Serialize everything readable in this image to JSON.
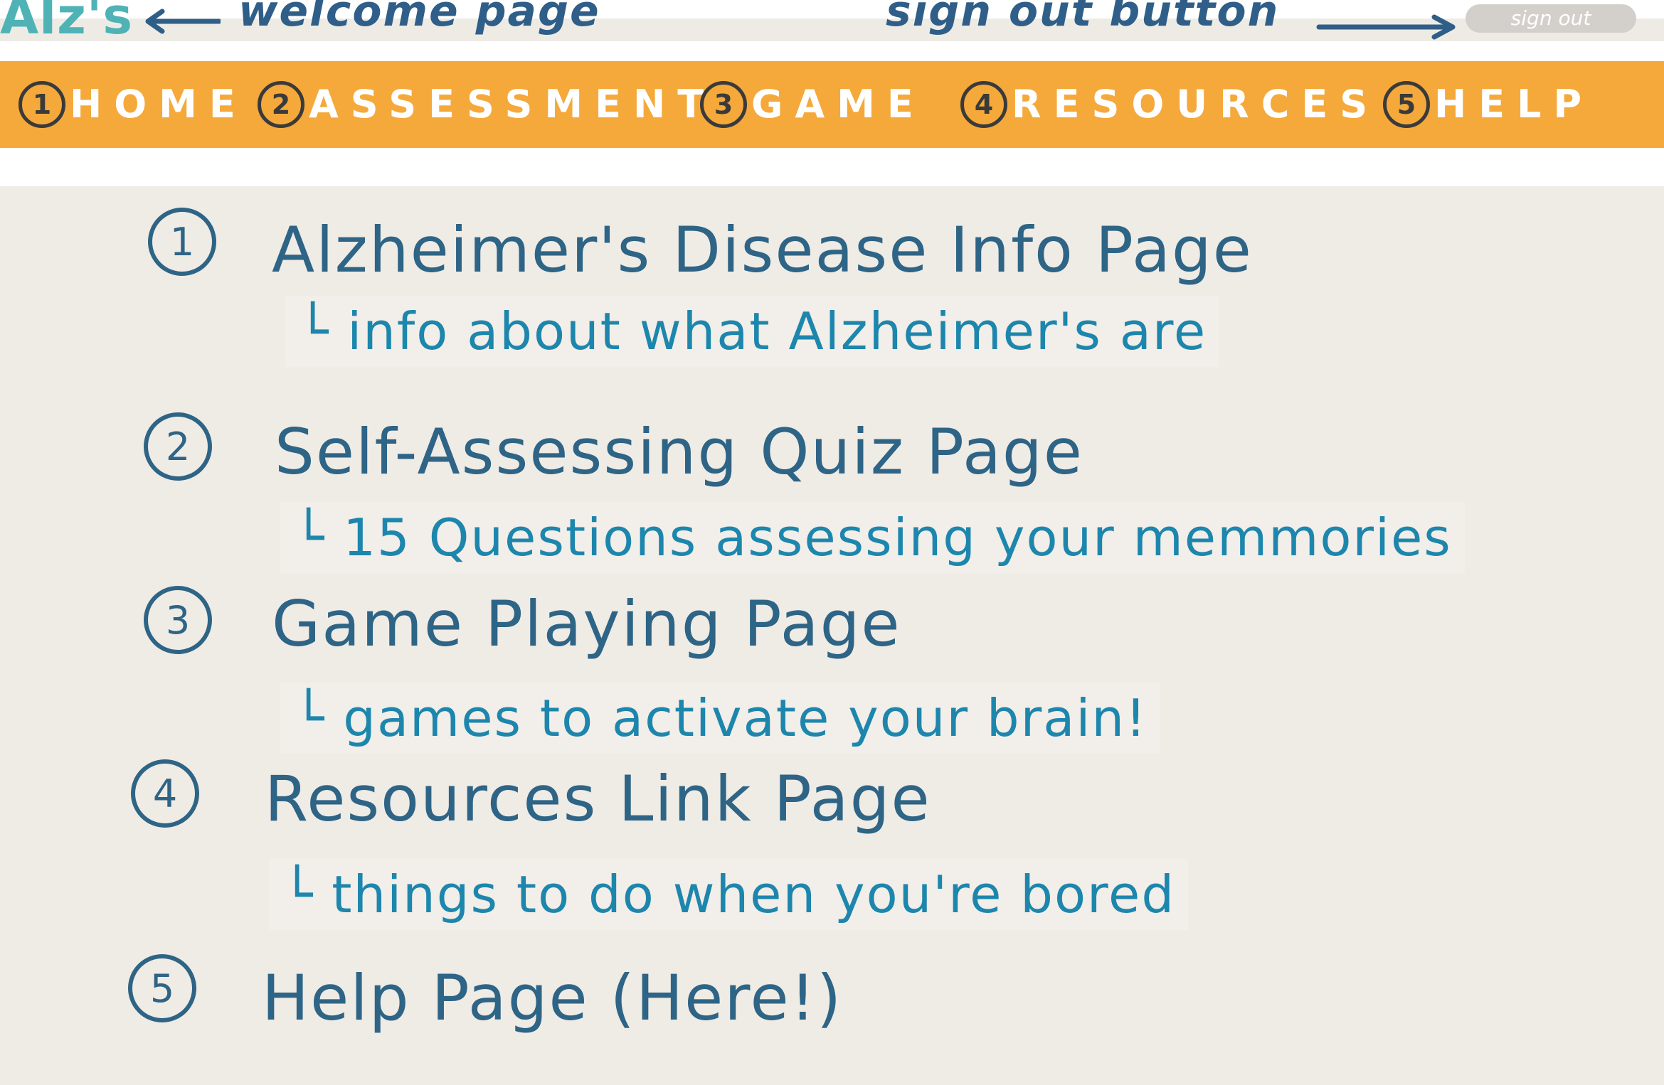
{
  "header": {
    "logo": "Alz's",
    "welcome_annotation": "welcome page",
    "signout_annotation": "sign out button",
    "signout_label": "sign out"
  },
  "nav": {
    "items": [
      {
        "num": "1",
        "label": "HOME"
      },
      {
        "num": "2",
        "label": "ASSESSMENT"
      },
      {
        "num": "3",
        "label": "GAME"
      },
      {
        "num": "4",
        "label": "RESOURCES"
      },
      {
        "num": "5",
        "label": "HELP"
      }
    ]
  },
  "pages": [
    {
      "num": "1",
      "title": "Alzheimer's Disease Info Page",
      "desc": "└ info about what Alzheimer's are"
    },
    {
      "num": "2",
      "title": "Self-Assessing Quiz Page",
      "desc": "└ 15 Questions assessing your memmories"
    },
    {
      "num": "3",
      "title": "Game Playing Page",
      "desc": "└ games to activate your brain!"
    },
    {
      "num": "4",
      "title": "Resources Link Page",
      "desc": "└ things to do when you're bored"
    },
    {
      "num": "5",
      "title": "Help Page (Here!)"
    }
  ],
  "colors": {
    "nav_bg": "#f5a93a",
    "logo": "#4fb3b6",
    "heading_ink": "#2e6485",
    "desc_ink": "#1d86ad",
    "content_bg": "#efebe5"
  }
}
